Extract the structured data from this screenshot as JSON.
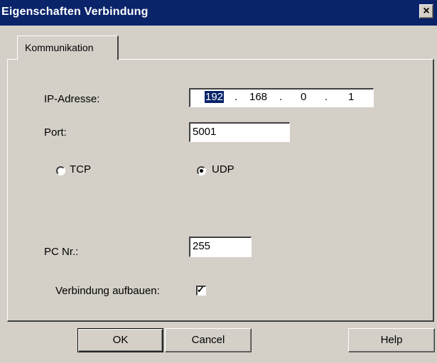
{
  "window": {
    "title": "Eigenschaften Verbindung",
    "close_glyph": "×"
  },
  "tabs": [
    {
      "label": "Kommunikation"
    }
  ],
  "form": {
    "ip_label": "IP-Adresse:",
    "ip": [
      "192",
      "168",
      "0",
      "1"
    ],
    "ip_separator": ".",
    "port_label": "Port:",
    "port_value": "5001",
    "protocol": {
      "options": [
        {
          "label": "TCP",
          "selected": false
        },
        {
          "label": "UDP",
          "selected": true
        }
      ]
    },
    "pc_label": "PC Nr.:",
    "pc_value": "255",
    "connect_label": "Verbindung aufbauen:",
    "connect_checked": true,
    "check_glyph": "✓"
  },
  "buttons": {
    "ok": "OK",
    "cancel": "Cancel",
    "help": "Help"
  }
}
